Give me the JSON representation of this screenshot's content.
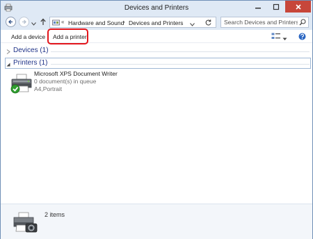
{
  "window": {
    "title": "Devices and Printers"
  },
  "address_bar": {
    "overflow": "«",
    "crumbs": [
      "Hardware and Sound",
      "Devices and Printers"
    ],
    "separator": "›"
  },
  "search": {
    "placeholder": "Search Devices and Printers"
  },
  "toolbar": {
    "add_device": "Add a device",
    "add_printer": "Add a printer"
  },
  "groups": {
    "devices": "Devices (1)",
    "printers": "Printers (1)"
  },
  "printer": {
    "name": "Microsoft XPS Document Writer",
    "status": "0 document(s) in queue",
    "paper": "A4,Portrait"
  },
  "details": {
    "count": "2 items"
  },
  "colors": {
    "accent": "#1e3287",
    "highlight": "#e3141a",
    "close": "#c7463a"
  },
  "icons": {
    "back": "arrow-left-icon",
    "forward": "arrow-right-icon",
    "up": "arrow-up-icon",
    "search": "magnifier-icon",
    "refresh": "refresh-icon",
    "help": "help-icon",
    "printer": "printer-icon"
  }
}
